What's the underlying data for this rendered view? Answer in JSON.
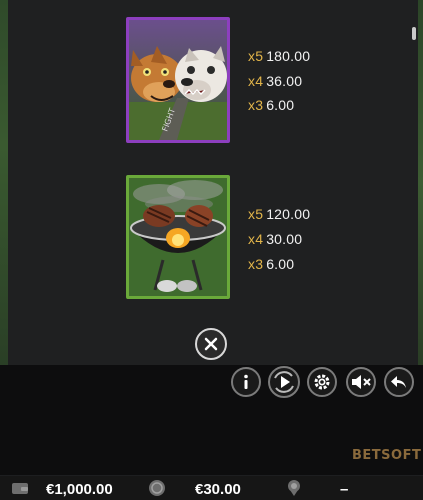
{
  "paytable": {
    "symbols": [
      {
        "name": "bulldogs",
        "payouts": [
          {
            "mult": "x5",
            "value": "180.00"
          },
          {
            "mult": "x4",
            "value": "36.00"
          },
          {
            "mult": "x3",
            "value": "6.00"
          }
        ]
      },
      {
        "name": "barbecue-grill",
        "payouts": [
          {
            "mult": "x5",
            "value": "120.00"
          },
          {
            "mult": "x4",
            "value": "30.00"
          },
          {
            "mult": "x3",
            "value": "6.00"
          }
        ]
      }
    ]
  },
  "controls": {
    "close_icon": "close-icon",
    "buttons": [
      "info-icon",
      "autoplay-icon",
      "settings-icon",
      "sound-mute-icon",
      "back-icon"
    ]
  },
  "brand": {
    "logo_text": "BETSOFT"
  },
  "status": {
    "balance": "€1,000.00",
    "bet": "€30.00",
    "win": "–"
  },
  "colors": {
    "multiplier": "#e2b54a",
    "dogs_frame": "#8d3fbf",
    "grill_frame": "#6aa93a",
    "logo": "#8a6a3c"
  }
}
